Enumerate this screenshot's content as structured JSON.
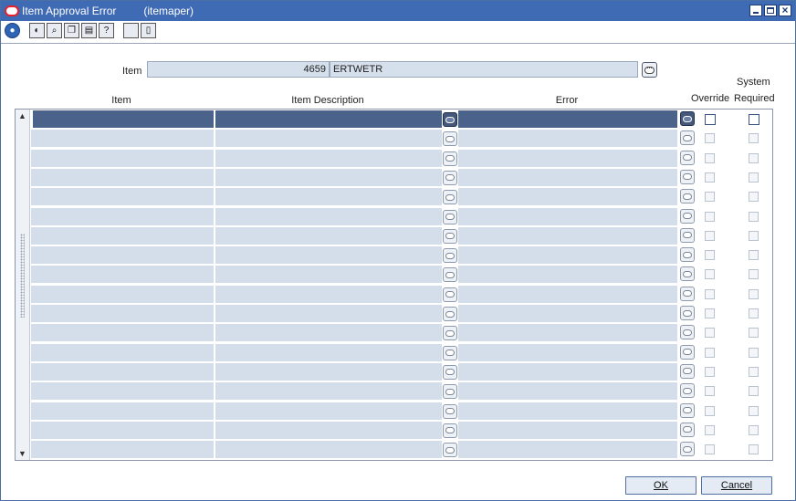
{
  "window": {
    "title": "Item Approval Error",
    "form_name": "(itemaper)",
    "controls": [
      "minimize-icon",
      "maximize-icon",
      "close-icon"
    ]
  },
  "toolbar": {
    "buttons": [
      {
        "name": "globe-icon"
      },
      {
        "name": "action-icon"
      },
      {
        "name": "find-icon"
      },
      {
        "name": "copy-icon"
      },
      {
        "name": "print-icon"
      },
      {
        "name": "help-icon"
      },
      {
        "name": "blank-icon"
      },
      {
        "name": "document-icon"
      }
    ]
  },
  "header": {
    "item_label": "Item",
    "item_number": "4659",
    "item_description": "ERTWETR"
  },
  "grid": {
    "columns": {
      "item": "Item",
      "description": "Item Description",
      "error": "Error",
      "override": "Override",
      "system_required_1": "System",
      "system_required_2": "Required"
    },
    "row_count": 18,
    "selected_row": 0
  },
  "buttons": {
    "ok": "OK",
    "cancel": "Cancel"
  },
  "colors": {
    "titlebar": "#3f6ab4",
    "cell_bg": "#d4deeb",
    "selected_row": "#4b638a"
  }
}
